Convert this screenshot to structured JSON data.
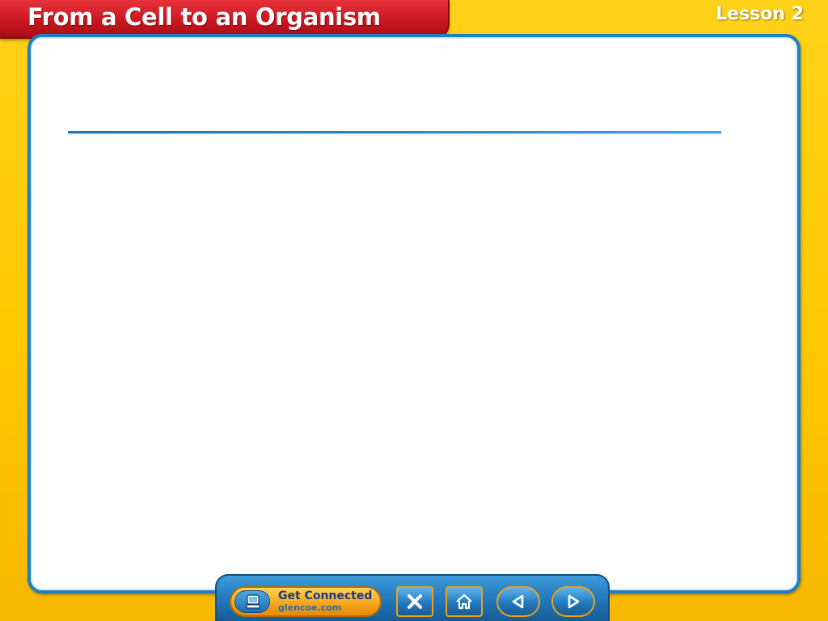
{
  "header": {
    "title": "From a Cell to an Organism",
    "lesson": "Lesson 2"
  },
  "nav": {
    "get_connected_title": "Get Connected",
    "get_connected_url": "glencoe.com"
  },
  "colors": {
    "background": "#ffc800",
    "banner": "#c8151f",
    "card_border": "#1f7fc4",
    "nav_bar": "#1e74b7",
    "button_outline": "#f0a014"
  },
  "icons": {
    "get_connected": "computer-icon",
    "close": "close-icon",
    "home": "home-icon",
    "previous": "arrow-left-icon",
    "next": "arrow-right-icon"
  }
}
